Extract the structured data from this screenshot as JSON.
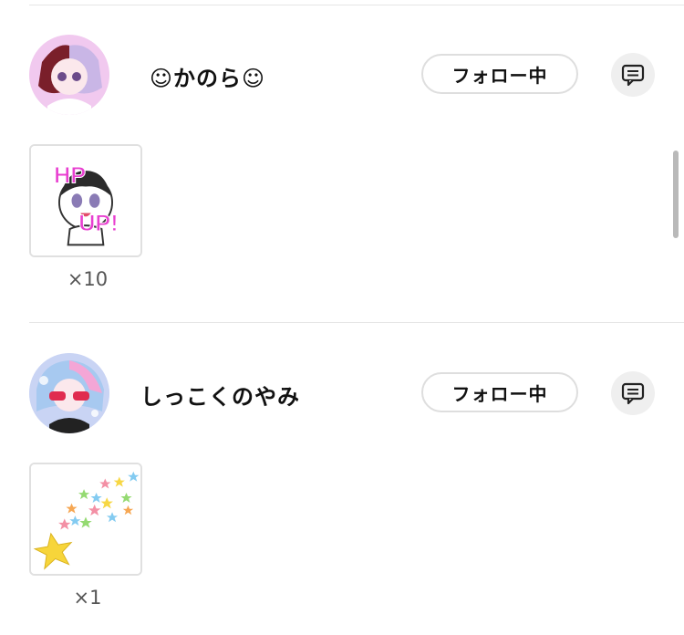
{
  "gifters": [
    {
      "username": "☺かのら☺",
      "follow_label": "フォロー中",
      "gift_label": "HP UP!",
      "gift_count": "×10",
      "gift_icon": "hp-up-sticker-icon"
    },
    {
      "username": "しっこくのやみ",
      "follow_label": "フォロー中",
      "gift_count": "×1",
      "gift_icon": "shooting-star-icon"
    }
  ],
  "icons": {
    "message": "message-icon"
  },
  "colors": {
    "accent_pink": "#e83fd0",
    "button_border": "#dedede",
    "icon_bg": "#efefef"
  }
}
